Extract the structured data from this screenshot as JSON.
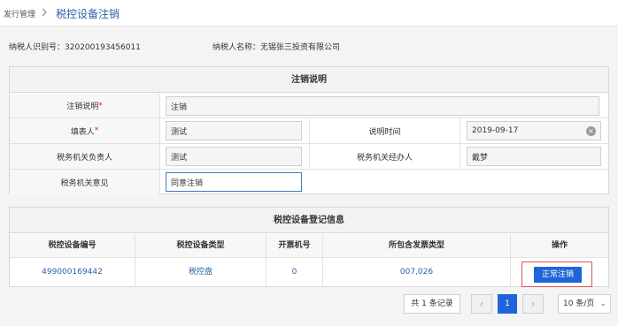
{
  "breadcrumb": {
    "parent": "发行管理",
    "current": "税控设备注销"
  },
  "taxpayer": {
    "id_label": "纳税人识别号：",
    "id_value": "320200193456011",
    "name_label": "纳税人名称：",
    "name_value": "无锡张三投资有限公司"
  },
  "cancel_section": {
    "title": "注销说明",
    "reason_label": "注销说明",
    "reason_value": "注销",
    "filler_label": "填表人",
    "filler_value": "测试",
    "time_label": "说明时间",
    "time_value": "2019-09-17",
    "officer_label": "税务机关负责人",
    "officer_value": "测试",
    "handler_label": "税务机关经办人",
    "handler_value": "戴梦",
    "opinion_label": "税务机关意见",
    "opinion_value": "同意注销",
    "required_mark": "*"
  },
  "device_section": {
    "title": "税控设备登记信息",
    "columns": [
      "税控设备编号",
      "税控设备类型",
      "开票机号",
      "所包含发票类型",
      "操作"
    ],
    "rows": [
      {
        "device_no": "499000169442",
        "device_type": "税控盘",
        "machine_no": "0",
        "invoice_types": "007,026",
        "action": "正常注销"
      }
    ]
  },
  "pagination": {
    "total": "共 1 条记录",
    "current_page": "1",
    "prev": "‹",
    "next": "›",
    "page_size": "10 条/页"
  },
  "colors": {
    "accent": "#1f64d8",
    "link": "#2a63a8",
    "required": "#e02020",
    "highlight": "#e05252"
  }
}
